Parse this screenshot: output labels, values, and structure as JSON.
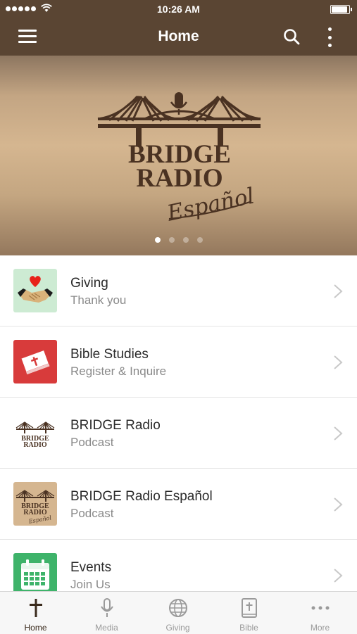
{
  "status_bar": {
    "time": "10:26 AM",
    "battery_level": 1.0
  },
  "nav": {
    "title": "Home",
    "menu_icon": "hamburger-menu-icon",
    "search_icon": "search-icon",
    "more_icon": "more-vertical-icon"
  },
  "hero": {
    "logo_text_line1": "BRIDGE",
    "logo_text_line2": "RADIO",
    "logo_script": "Español",
    "page_count": 4,
    "active_page": 1
  },
  "colors": {
    "brand": "#5a4533",
    "hero": "#d5b690",
    "logo_ink": "#4a3222",
    "giving_bg": "#cdebd3",
    "bible_red": "#d83b3b",
    "events_green": "#3eb36a"
  },
  "list": [
    {
      "title": "Giving",
      "subtitle": "Thank you",
      "icon": "giving-handshake-heart-icon"
    },
    {
      "title": "Bible Studies",
      "subtitle": "Register & Inquire",
      "icon": "bible-book-icon"
    },
    {
      "title": "BRIDGE Radio",
      "subtitle": "Podcast",
      "icon": "bridge-radio-logo-icon"
    },
    {
      "title": "BRIDGE Radio Español",
      "subtitle": "Podcast",
      "icon": "bridge-radio-espanol-logo-icon"
    },
    {
      "title": "Events",
      "subtitle": "Join Us",
      "icon": "calendar-icon"
    }
  ],
  "thumb_text": {
    "line1": "BRIDGE",
    "line2": "RADIO",
    "script": "Español"
  },
  "tabs": [
    {
      "label": "Home",
      "icon": "cross-icon",
      "active": true
    },
    {
      "label": "Media",
      "icon": "microphone-icon",
      "active": false
    },
    {
      "label": "Giving",
      "icon": "globe-icon",
      "active": false
    },
    {
      "label": "Bible",
      "icon": "bible-icon",
      "active": false
    },
    {
      "label": "More",
      "icon": "more-horizontal-icon",
      "active": false
    }
  ]
}
